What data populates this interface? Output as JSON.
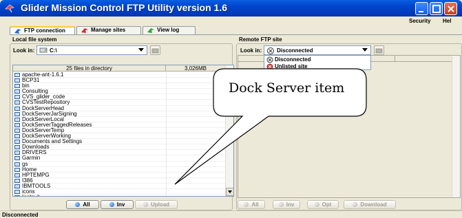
{
  "window": {
    "title": "Glider Mission Control FTP Utility version 1.6"
  },
  "menu": [
    "Security",
    "Hel"
  ],
  "tabs": [
    {
      "label": "FTP connection"
    },
    {
      "label": "Manage sites"
    },
    {
      "label": "View log"
    }
  ],
  "local": {
    "title": "Local file system",
    "lookin_label": "Look in:",
    "lookin_value": "C:\\",
    "header_name": "25 files in directory",
    "header_size": "3,026MB",
    "files": [
      "apache-ant-1.6.1",
      "BCP31",
      "bin",
      "Consulting",
      "CVS_glider_code",
      "CVSTestRepository",
      "DockServerHead",
      "DockServerJarSigning",
      "DockServerLocal",
      "DockServerTaggedReleases",
      "DockServerTemp",
      "DockServerWorking",
      "Documents and Settings",
      "Downloads",
      "DRIVERS",
      "Garmin",
      "gs",
      "Home",
      "HPTEMPG",
      "I386",
      "IBMTOOLS",
      "icons",
      "Inetpub"
    ],
    "buttons": {
      "all": "All",
      "inv": "Inv",
      "upload": "Upload"
    }
  },
  "remote": {
    "title": "Remote FTP site",
    "lookin_label": "Look in:",
    "lookin_value": "Disconnected",
    "dropdown_items": [
      "Disconnected",
      "Unlisted site"
    ],
    "buttons": {
      "all": "All",
      "inv": "Inv",
      "opt": "Opt",
      "download": "Download"
    }
  },
  "callout": {
    "text": "Dock Server item"
  },
  "status": {
    "text": "Disconnected"
  },
  "colors": {
    "title_bar": "#0044cc",
    "active_tab_accent": "#ffc83c",
    "close_button": "#c8401c"
  }
}
